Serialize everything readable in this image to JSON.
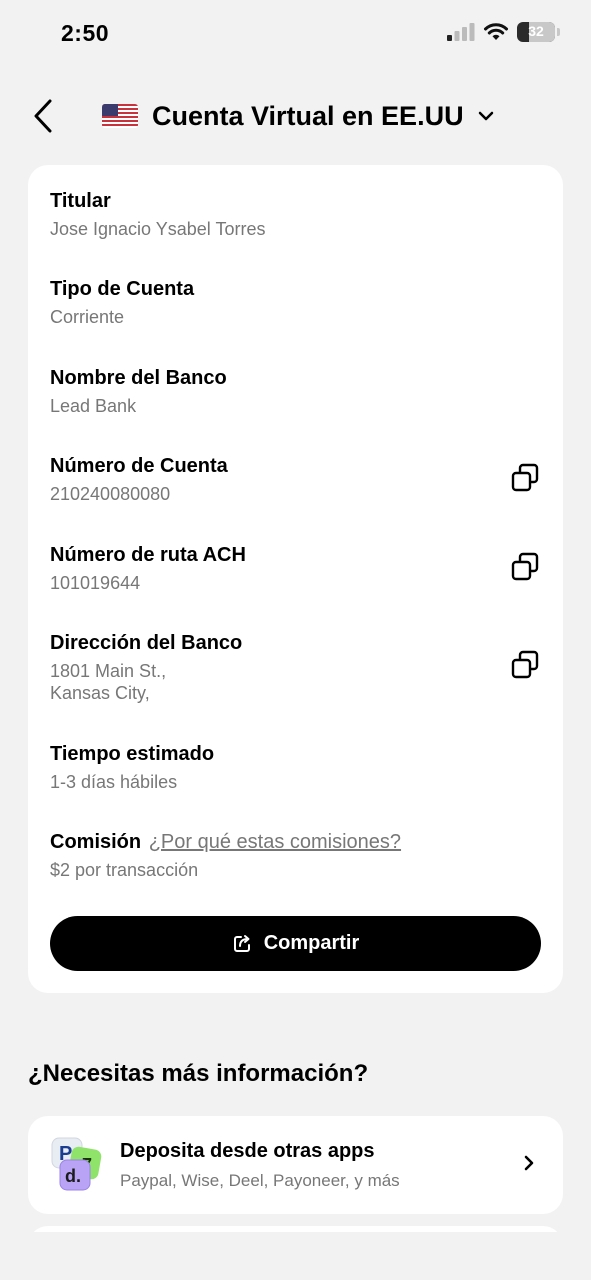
{
  "status_bar": {
    "time": "2:50",
    "battery": "32",
    "battery_level": 0.32
  },
  "header": {
    "title": "Cuenta Virtual en EE.UU",
    "back_icon": "chevron-left-icon",
    "dropdown_icon": "chevron-down-icon",
    "flag_icon": "us-flag-icon"
  },
  "account": {
    "fields": [
      {
        "label": "Titular",
        "value": "Jose Ignacio Ysabel Torres"
      },
      {
        "label": "Tipo de Cuenta",
        "value": "Corriente"
      },
      {
        "label": "Nombre del Banco",
        "value": "Lead Bank"
      },
      {
        "label": "Número de Cuenta",
        "value": "210240080080",
        "copyable": true
      },
      {
        "label": "Número de ruta ACH",
        "value": "101019644",
        "copyable": true
      },
      {
        "label": "Dirección del Banco",
        "value_line1": "1801 Main St.,",
        "value_line2": "Kansas City,",
        "copyable": true
      },
      {
        "label": "Tiempo estimado",
        "value": "1-3 días hábiles"
      },
      {
        "label": "Comisión",
        "link": "¿Por qué estas comisiones?",
        "value": "$2 por transacción"
      }
    ],
    "share_label": "Compartir"
  },
  "more_info": {
    "title": "¿Necesitas más información?",
    "apps_title": "Deposita desde otras apps",
    "apps_subtitle": "Paypal, Wise, Deel, Payoneer, y más",
    "logo_letter": "d."
  },
  "colors": {
    "background": "#f2f2f2",
    "card": "#ffffff",
    "primary_button": "#000000",
    "secondary_text": "#777777"
  }
}
